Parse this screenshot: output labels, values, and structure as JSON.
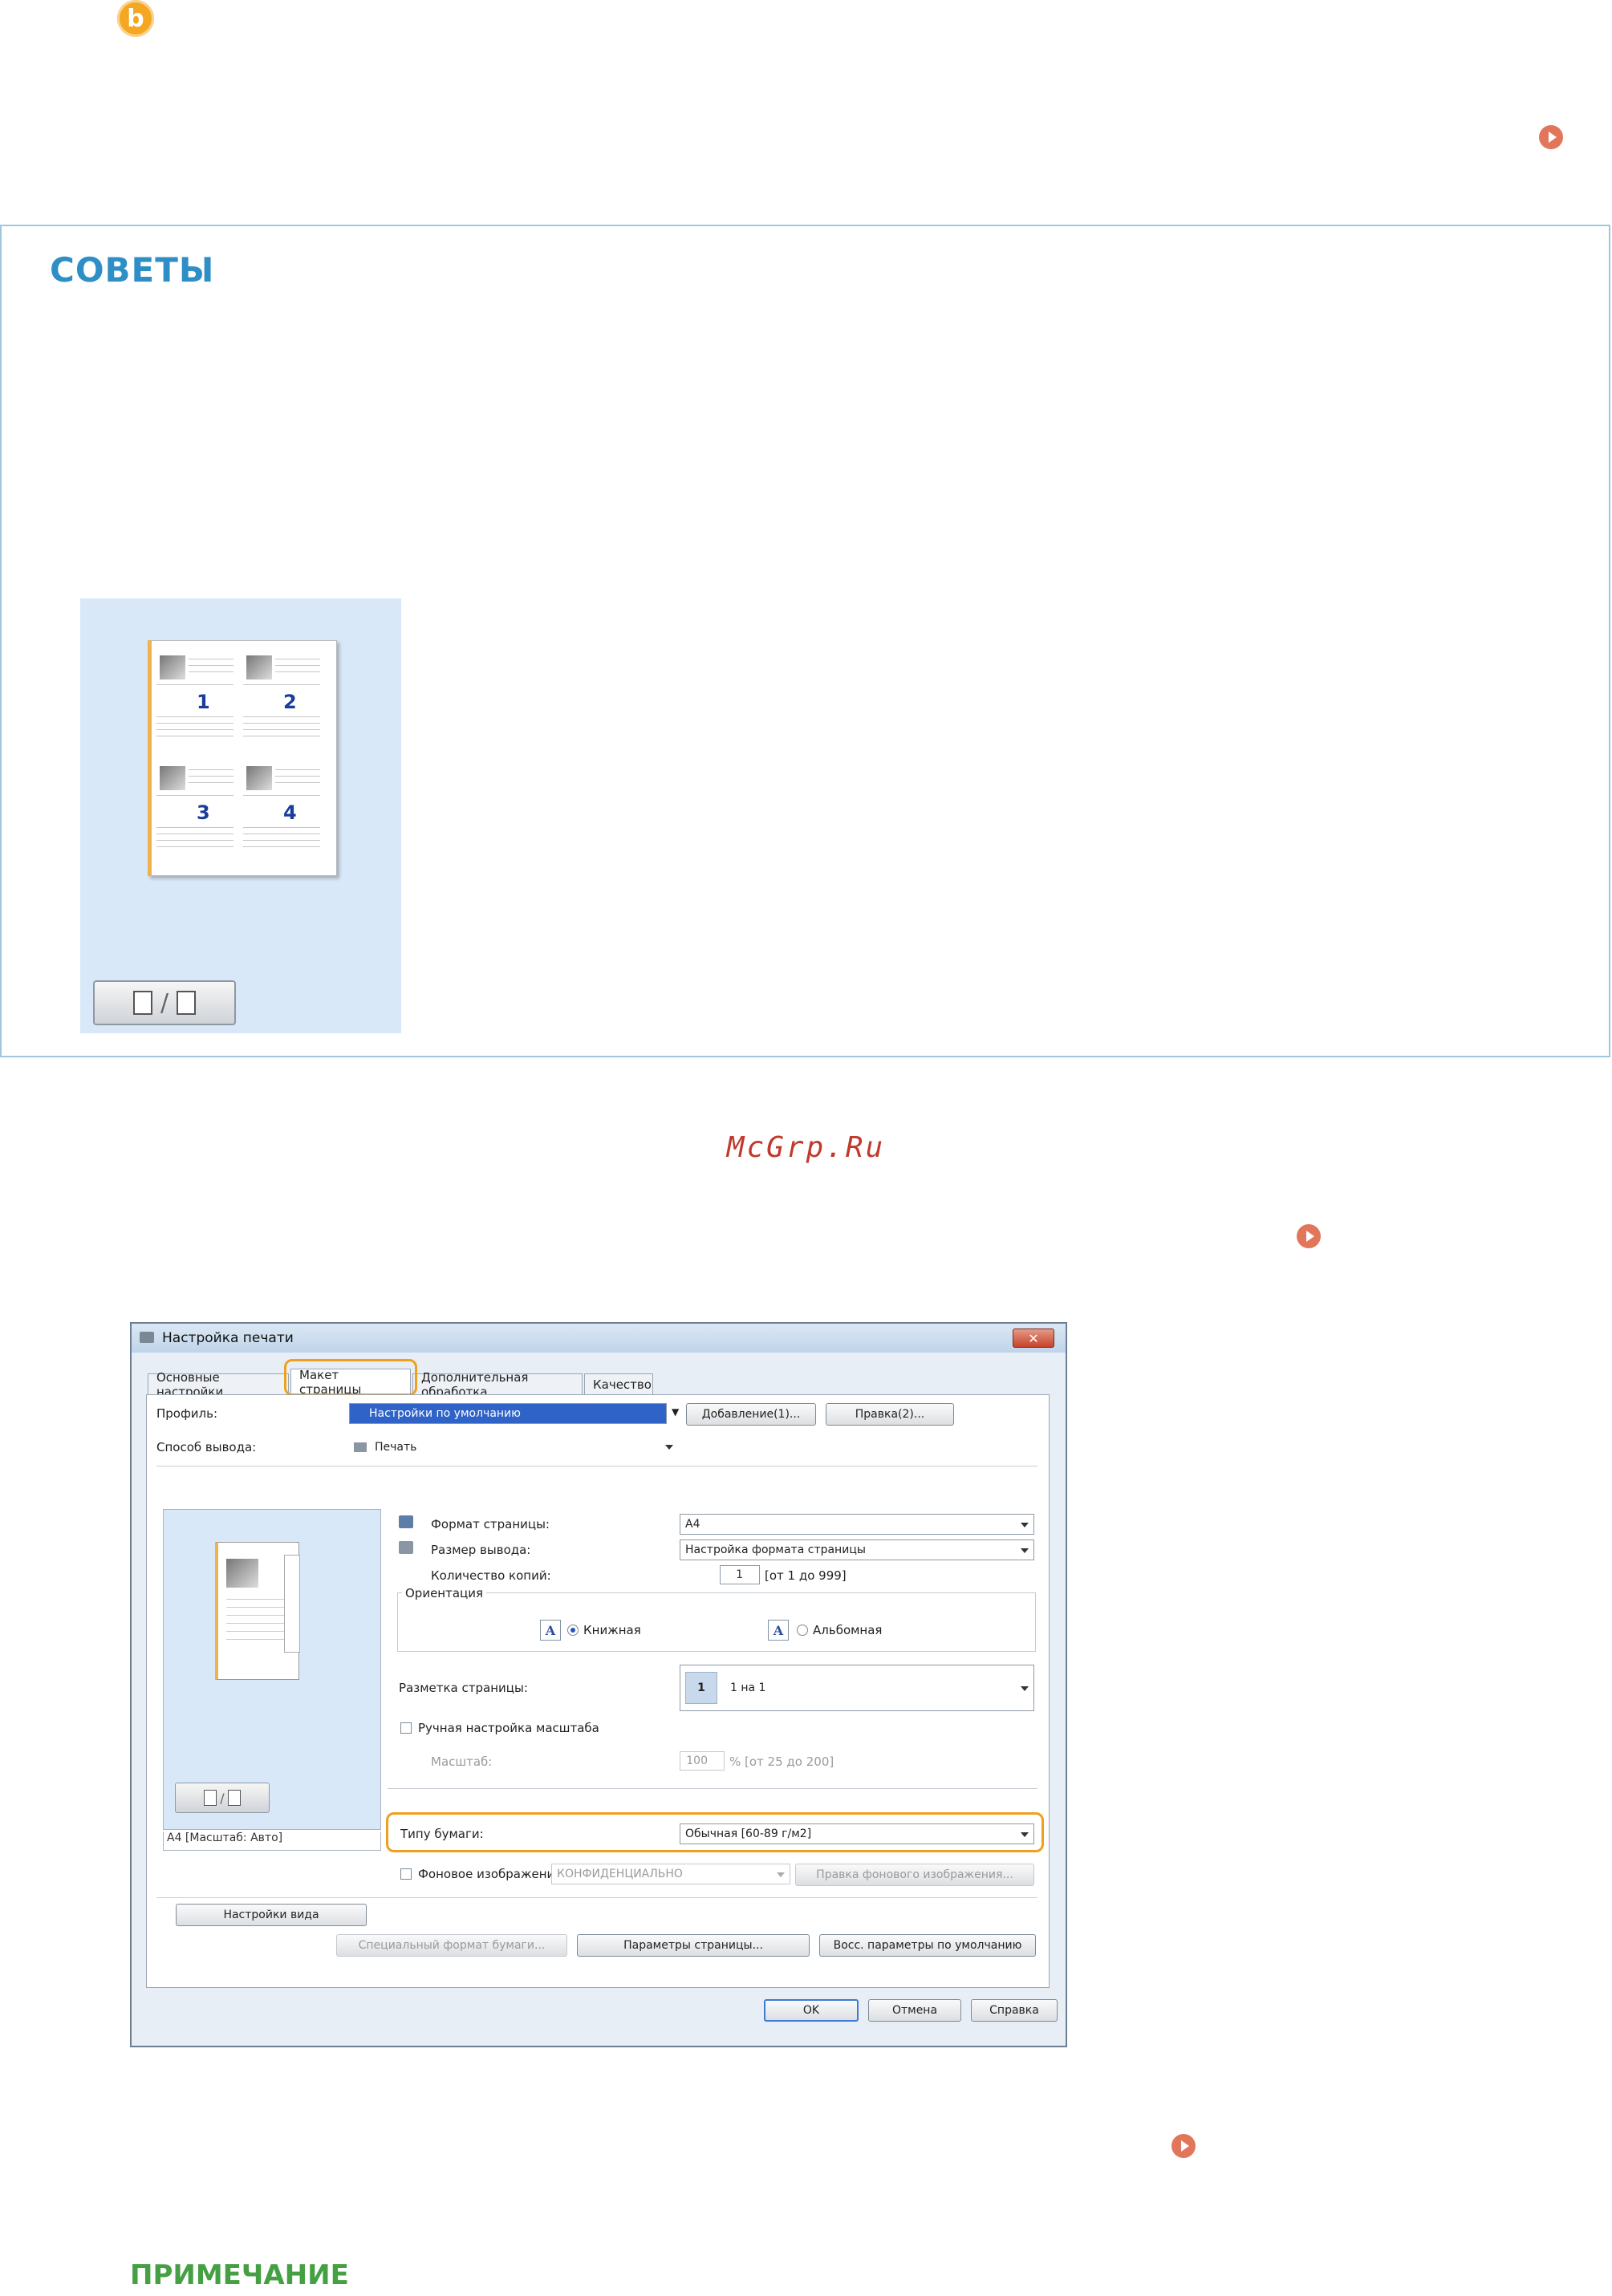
{
  "step_badge": "b",
  "tips": {
    "title": "СОВЕТЫ"
  },
  "layout_preview": {
    "page_numbers": [
      "1",
      "2",
      "3",
      "4"
    ]
  },
  "watermark": "McGrp.Ru",
  "dialog": {
    "title": "Настройка печати",
    "close_label": "✕",
    "tabs": [
      "Основные настройки",
      "Макет страницы",
      "Дополнительная обработка",
      "Качество"
    ],
    "profile_label": "Профиль:",
    "profile_value": "Настройки по умолчанию",
    "add_button": "Добавление(1)...",
    "edit_button": "Правка(2)...",
    "output_method_label": "Способ вывода:",
    "output_method_value": "Печать",
    "page_size_label": "Формат страницы:",
    "page_size_value": "A4",
    "output_size_label": "Размер вывода:",
    "output_size_value": "Настройка формата страницы",
    "copies_label": "Количество копий:",
    "copies_value": "1",
    "copies_range": "[от 1 до 999]",
    "orientation_label": "Ориентация",
    "portrait_label": "Книжная",
    "landscape_label": "Альбомная",
    "orientation_icon": "A",
    "page_layout_label": "Разметка страницы:",
    "page_layout_icon": "1",
    "page_layout_value": "1 на 1",
    "manual_scale_label": "Ручная настройка масштаба",
    "scale_label": "Масштаб:",
    "scale_value": "100",
    "scale_range": "% [от 25 до 200]",
    "preview_caption": "A4 [Масштаб: Авто]",
    "view_settings_button": "Настройки вида",
    "paper_type_label": "Типу бумаги:",
    "paper_type_value": "Обычная [60-89 г/м2]",
    "watermark_label": "Фоновое изображение",
    "watermark_value": "КОНФИДЕНЦИАЛЬНО",
    "watermark_edit_button": "Правка фонового изображения...",
    "custom_paper_button": "Специальный формат бумаги...",
    "page_options_button": "Параметры страницы...",
    "restore_defaults_button": "Восс. параметры по умолчанию",
    "ok_button": "OK",
    "cancel_button": "Отмена",
    "help_button": "Справка"
  },
  "note": {
    "title": "ПРИМЕЧАНИЕ"
  },
  "colors": {
    "accent_orange": "#f0a01f",
    "tips_blue": "#2e8fc6",
    "note_green": "#44a043",
    "link_arrow": "#e2765a"
  }
}
